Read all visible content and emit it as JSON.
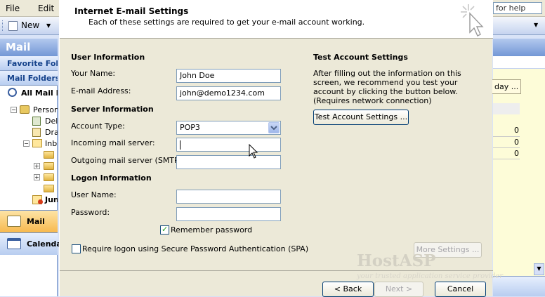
{
  "outlook": {
    "menu": [
      "File",
      "Edit"
    ],
    "toolbar": {
      "new_label": "New",
      "help_placeholder": "for help"
    },
    "nav": {
      "header": "Mail",
      "favorite_folders": "Favorite Fold",
      "mail_folders": "Mail Folders",
      "all_mail": "All Mail Ite",
      "tree": [
        "Person",
        "Del",
        "Dra",
        "Inb",
        "Jun"
      ],
      "mail_button": "Mail",
      "calendar_button": "Calenda"
    },
    "right": {
      "today_button": "day ...",
      "counts": [
        "0",
        "0",
        "0"
      ]
    }
  },
  "dialog": {
    "title": "Internet E-mail Settings",
    "subtitle": "Each of these settings are required to get your e-mail account working.",
    "user_info": {
      "heading": "User Information",
      "name_label": "Your Name:",
      "name_value": "John Doe",
      "email_label": "E-mail Address:",
      "email_value": "john@demo1234.com"
    },
    "server_info": {
      "heading": "Server Information",
      "account_type_label": "Account Type:",
      "account_type_value": "POP3",
      "incoming_label": "Incoming mail server:",
      "incoming_value": "",
      "outgoing_label": "Outgoing mail server (SMTP):",
      "outgoing_value": ""
    },
    "logon_info": {
      "heading": "Logon Information",
      "username_label": "User Name:",
      "username_value": "",
      "password_label": "Password:",
      "password_value": "",
      "remember_label": "Remember password",
      "remember_checked": true,
      "spa_label": "Require logon using Secure Password Authentication (SPA)",
      "spa_checked": false
    },
    "test": {
      "heading": "Test Account Settings",
      "description": "After filling out the information on this screen, we recommend you test your account by clicking the button below. (Requires network connection)",
      "button": "Test Account Settings ..."
    },
    "more_settings_button": "More Settings ...",
    "back_button": "< Back",
    "next_button": "Next >",
    "cancel_button": "Cancel"
  },
  "watermark": {
    "title": "HostASP",
    "tagline": "your trusted application service provider"
  }
}
